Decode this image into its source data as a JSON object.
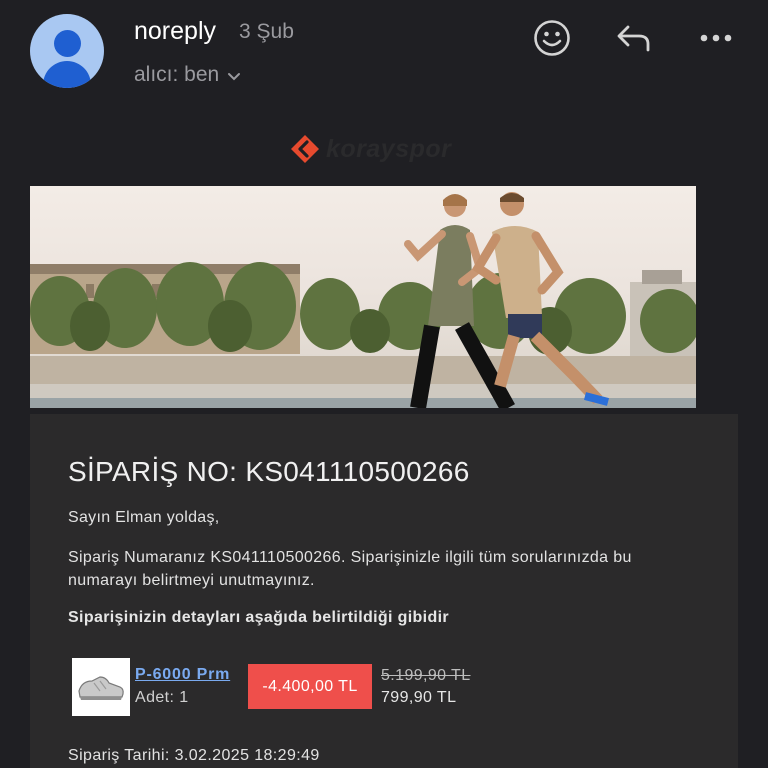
{
  "header": {
    "sender": "noreply",
    "date": "3 Şub",
    "recipient": "alıcı: ben",
    "icons": [
      "emoji-icon",
      "reply-icon",
      "more-icon"
    ]
  },
  "brand": {
    "name": "korayspor",
    "logo_color": "#e64a2e"
  },
  "email": {
    "order_title": "SİPARİŞ NO: KS041110500266",
    "greeting": "Sayın Elman yoldaş,",
    "body": "Sipariş Numaranız KS041110500266. Siparişinizle ilgili tüm sorularınızda bu numarayı belirtmeyi unutmayınız.",
    "details_heading": "Siparişinizin detayları aşağıda belirtildiği gibidir",
    "product": {
      "name": "P-6000 Prm",
      "quantity": "Adet: 1",
      "discount": "-4.400,00 TL",
      "old_price": "5.199,90 TL",
      "new_price": "799,90 TL"
    },
    "order_date": "Sipariş Tarihi: 3.02.2025 18:29:49"
  },
  "colors": {
    "background": "#1f1f23",
    "card": "#2b2a2b",
    "discount": "#ef4f4b",
    "link": "#7aaaf0",
    "avatar_bg": "#a9c8f2",
    "avatar_fg": "#1f5fd1"
  }
}
